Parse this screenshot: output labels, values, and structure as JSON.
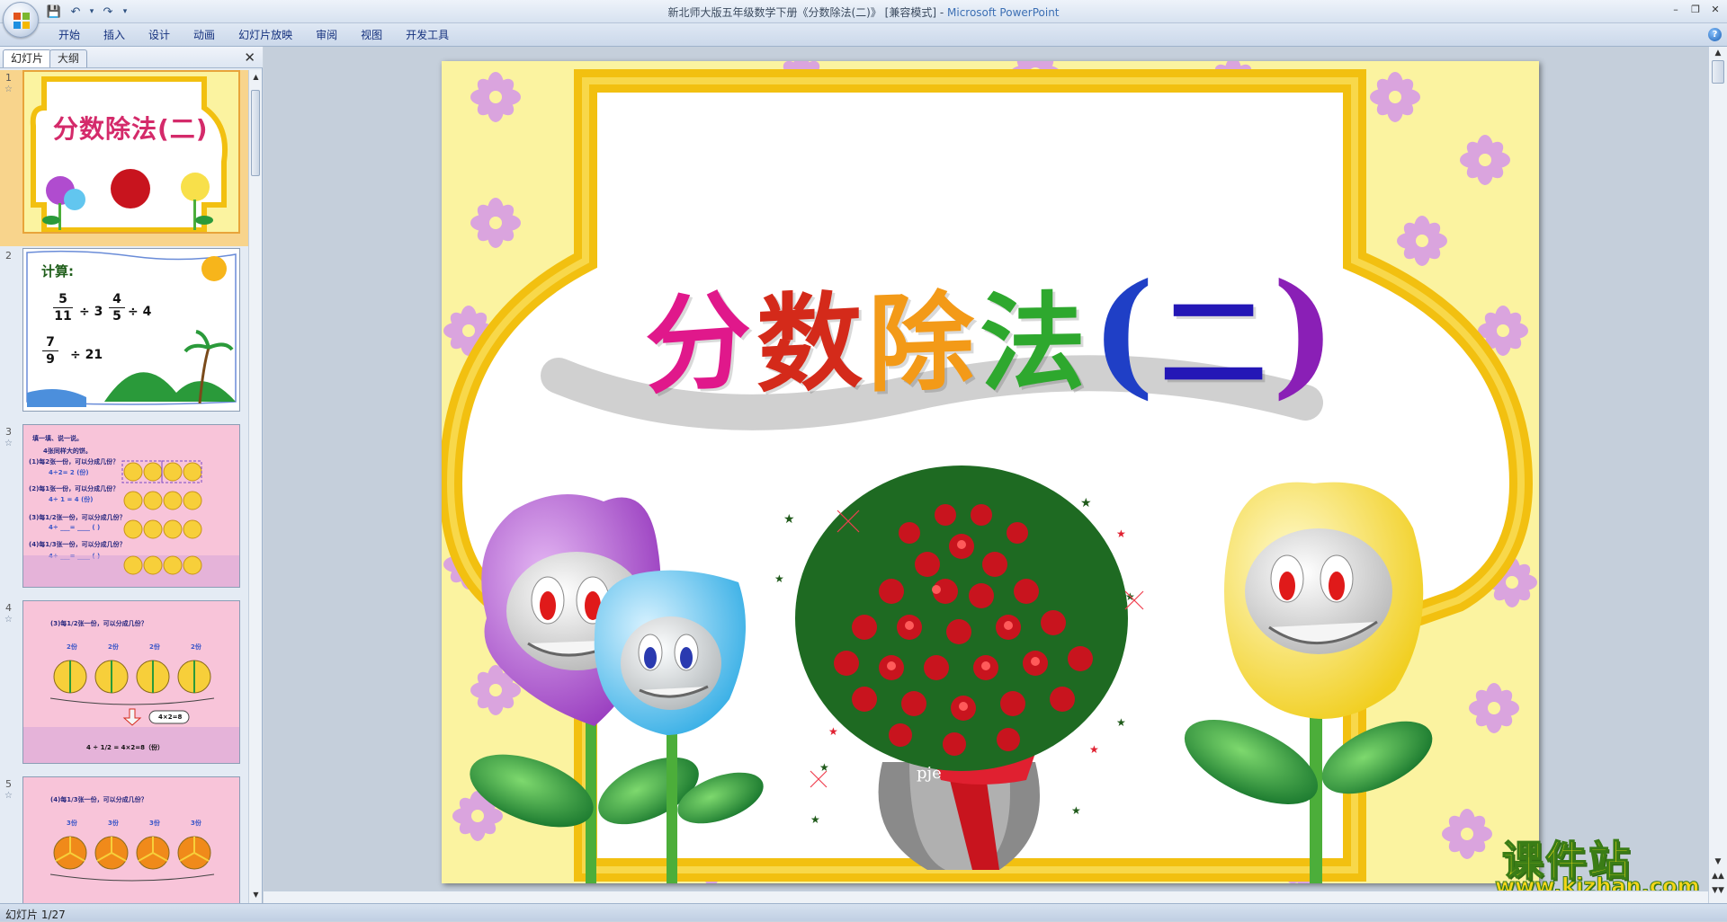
{
  "window": {
    "title_doc": "新北师大版五年级数学下册《分数除法(二)》 [兼容模式] - ",
    "title_app": "Microsoft PowerPoint"
  },
  "ribbon": {
    "tabs": [
      "开始",
      "插入",
      "设计",
      "动画",
      "幻灯片放映",
      "审阅",
      "视图",
      "开发工具"
    ]
  },
  "left_pane": {
    "tab_slides": "幻灯片",
    "tab_outline": "大纲",
    "thumbnails": [
      {
        "num": "1",
        "title": "分数除法(二)"
      },
      {
        "num": "2",
        "label": "计算:",
        "items": [
          {
            "num": "5",
            "den": "11",
            "op": "÷ 3"
          },
          {
            "num": "4",
            "den": "5",
            "op": "÷ 4"
          },
          {
            "num": "7",
            "den": "9",
            "op": "÷ 21"
          }
        ]
      },
      {
        "num": "3",
        "lines": [
          "填一填、说一说。",
          "4张同样大的饼。",
          "(1)每2张一份，可以分成几份？",
          "4÷2= 2 (份)",
          "(2)每1张一份，可以分成几份？",
          "4÷ 1 = 4 (份)",
          "(3)每1/2张一份，可以分成几份？",
          "4÷ ___= ____ ( )",
          "(4)每1/3张一份，可以分成几份？",
          "4÷ ___= ____ ( )"
        ]
      },
      {
        "num": "4",
        "lines": [
          "(3)每1/2张一份，可以分成几份？",
          "2份",
          "4×2=8",
          "4 ÷ 1/2 = 4×2=8（份）"
        ]
      },
      {
        "num": "5",
        "lines": [
          "(4)每1/3张一份，可以分成几份？",
          "3份"
        ]
      }
    ]
  },
  "slide": {
    "title_chars": [
      {
        "ch": "分",
        "color": "#e0188b"
      },
      {
        "ch": "数",
        "color": "#d42a1a"
      },
      {
        "ch": "除",
        "color": "#f39a18"
      },
      {
        "ch": "法",
        "color": "#2ea82e"
      },
      {
        "ch": "(",
        "color": "#1f3fc6"
      },
      {
        "ch": "二",
        "color": "#2417b6"
      },
      {
        "ch": ")",
        "color": "#8a1fb6"
      }
    ],
    "bouquet_label": "pje"
  },
  "status": {
    "slide_counter": "幻灯片 1/27"
  },
  "watermark": {
    "title": "课件站",
    "url": "www.kjzhan.com"
  },
  "colors": {
    "slide_bg": "#fbf3a0",
    "frame": "#f2c010",
    "flower_purple": "#b04ccf",
    "flower_blue": "#62c6ef",
    "flower_yellow": "#f8e04a",
    "leaf": "#2a9a3a",
    "selection": "#f8d48c"
  }
}
